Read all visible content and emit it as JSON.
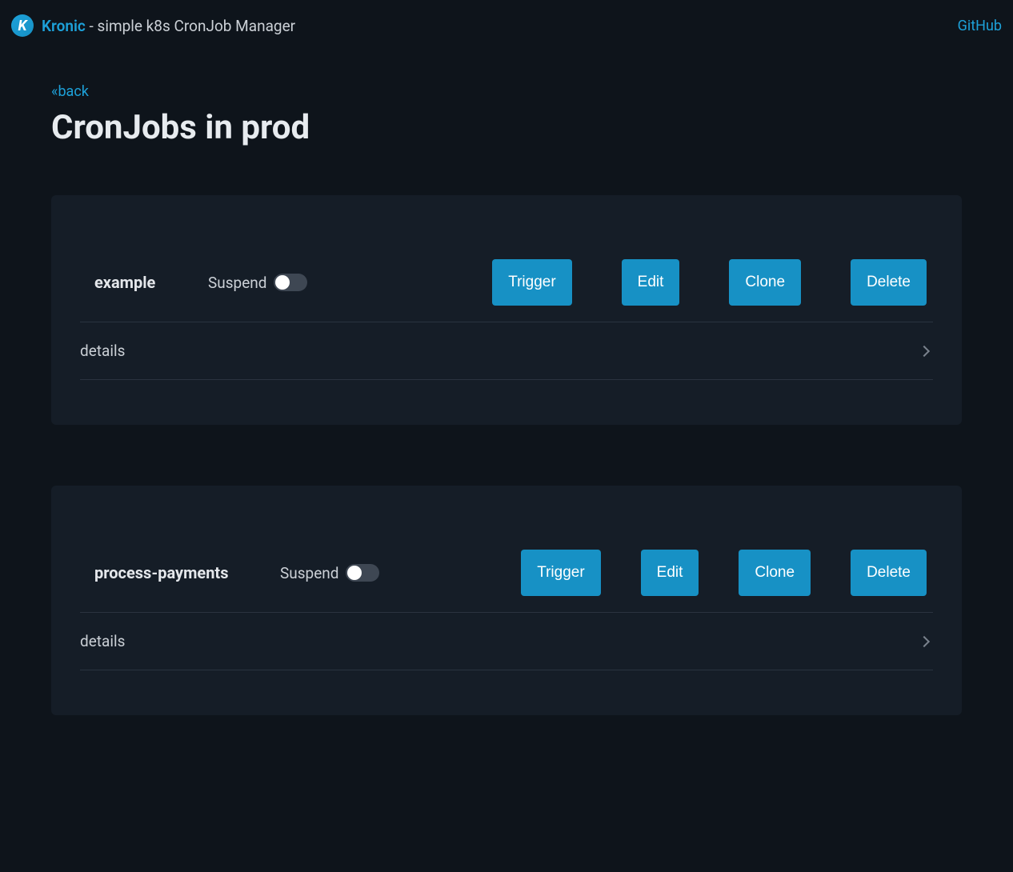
{
  "header": {
    "brand": "Kronic",
    "separator": " - ",
    "tagline": "simple k8s CronJob Manager",
    "github_label": "GitHub"
  },
  "nav": {
    "back_label": "«back"
  },
  "page": {
    "title": "CronJobs in prod"
  },
  "labels": {
    "suspend": "Suspend",
    "details": "details",
    "trigger": "Trigger",
    "edit": "Edit",
    "clone": "Clone",
    "delete": "Delete"
  },
  "cronjobs": [
    {
      "name": "example",
      "suspended": false
    },
    {
      "name": "process-payments",
      "suspended": false
    }
  ]
}
